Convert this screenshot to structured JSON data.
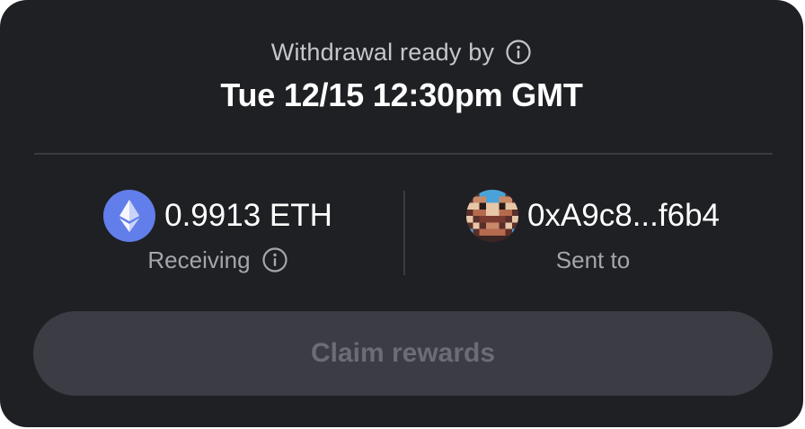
{
  "withdrawal": {
    "label": "Withdrawal ready by",
    "info_icon": "info-icon",
    "date": "Tue 12/15 12:30pm GMT"
  },
  "receiving": {
    "amount": "0.9913 ETH",
    "token_icon": "ethereum-icon",
    "label": "Receiving",
    "info_icon": "info-icon"
  },
  "sent_to": {
    "address": "0xA9c8...f6b4",
    "avatar_icon": "pixel-avatar-icon",
    "label": "Sent to"
  },
  "claim_button": {
    "label": "Claim rewards",
    "state": "disabled"
  },
  "colors": {
    "card_background": "#1f2024",
    "eth_blue": "#627eea",
    "button_background": "#3b3c44",
    "button_text_disabled": "#6b6d75"
  }
}
